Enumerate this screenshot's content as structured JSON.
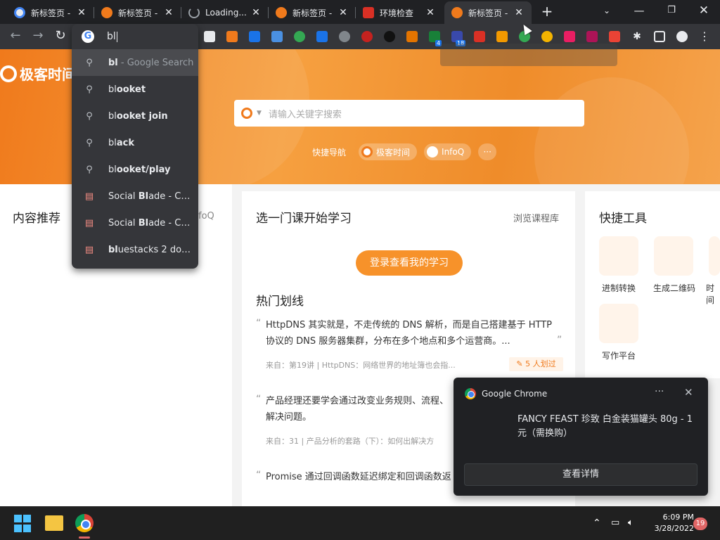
{
  "browser": {
    "tabs": [
      {
        "title": "新标签页 -",
        "favicon": "chrome-icon",
        "active": false
      },
      {
        "title": "新标签页 -",
        "favicon": "geekbang-icon",
        "active": false
      },
      {
        "title": "Loading...",
        "favicon": "loading-spinner-icon",
        "active": false
      },
      {
        "title": "新标签页 -",
        "favicon": "geekbang-icon",
        "active": false
      },
      {
        "title": "环境检查",
        "favicon": "red-figure-icon",
        "active": false
      },
      {
        "title": "新标签页 -",
        "favicon": "geekbang-icon",
        "active": true
      }
    ],
    "new_tab_label": "+",
    "omnibox": {
      "value": "bl",
      "suggestions": [
        {
          "icon": "search-icon",
          "bold": "bl",
          "rest": " - Google Search",
          "muted": true,
          "selected": true
        },
        {
          "icon": "search-icon",
          "bold": "bl",
          "rest": "ooket"
        },
        {
          "icon": "search-icon",
          "bold": "bl",
          "rest": "ooket join"
        },
        {
          "icon": "search-icon",
          "bold": "bl",
          "rest": "ack"
        },
        {
          "icon": "search-icon",
          "bold": "bl",
          "rest": "ooket/play"
        },
        {
          "icon": "history-page-icon",
          "pre": "Social ",
          "bold": "Bl",
          "rest": "ade - Chr..."
        },
        {
          "icon": "history-page-icon",
          "pre": "Social ",
          "bold": "Bl",
          "rest": "ade - Chr..."
        },
        {
          "icon": "history-page-icon",
          "bold": "bl",
          "rest": "uestacks 2 dow..."
        }
      ]
    },
    "extension_badges": [
      "4",
      "18"
    ]
  },
  "page": {
    "logo_text": "极客时间",
    "search_placeholder": "请输入关键字搜索",
    "quick_nav_label": "快捷导航",
    "quick_links": [
      "极客时间",
      "InfoQ"
    ],
    "more_label": "···",
    "left_card": {
      "title": "内容推荐",
      "partial_tab": "foQ"
    },
    "middle_card": {
      "title": "选一门课开始学习",
      "browse_link": "浏览课程库",
      "login_button": "登录查看我的学习",
      "hot_title": "热门划线",
      "items": [
        {
          "text": "HttpDNS 其实就是，不走传统的 DNS 解析，而是自己搭建基于 HTTP 协议的 DNS 服务器集群，分布在多个地点和多个运营商。...",
          "meta": "来自：第19讲 | HttpDNS：网络世界的地址簿也会指...",
          "badge": "5 人划过"
        },
        {
          "text": "产品经理还要学会通过改变业务规则、流程、解决问题。",
          "meta": "来自：31 | 产品分析的套路（下）：如何出解决方"
        },
        {
          "text": "Promise 通过回调函数延迟绑定和回调函数返"
        }
      ]
    },
    "right_card": {
      "title": "快捷工具",
      "tools": [
        "进制转换",
        "生成二维码",
        "时间",
        "写作平台"
      ]
    }
  },
  "notification": {
    "app": "Google Chrome",
    "more": "···",
    "close": "✕",
    "message": "FANCY FEAST 珍致 白金装猫罐头 80g - 1元（需换购）",
    "action": "查看详情"
  },
  "taskbar": {
    "time": "6:09 PM",
    "date": "3/28/2022",
    "notification_count": "19"
  },
  "colors": {
    "accent_orange": "#f07a1c",
    "button_orange": "#f7922a",
    "chrome_dark": "#202124"
  }
}
